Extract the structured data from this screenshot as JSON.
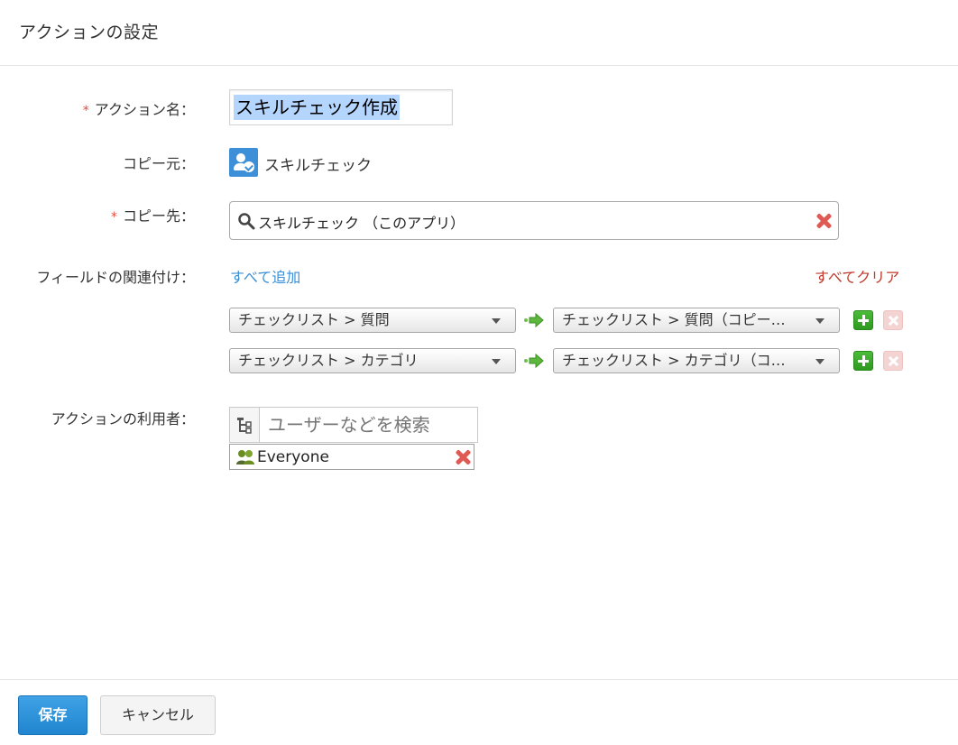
{
  "dialog": {
    "title": "アクションの設定"
  },
  "form": {
    "required_mark": "*",
    "action_name": {
      "label": "アクション名：",
      "value": "スキルチェック作成"
    },
    "copy_source": {
      "label": "コピー元：",
      "app_name": "スキルチェック",
      "icon": "app-person-check-icon"
    },
    "copy_dest": {
      "label": "コピー先：",
      "value": "スキルチェック （このアプリ）"
    },
    "field_mapping": {
      "label": "フィールドの関連付け：",
      "add_all": "すべて追加",
      "clear_all": "すべてクリア",
      "rows": [
        {
          "source": "チェックリスト > 質問",
          "dest": "チェックリスト > 質問（コピー…"
        },
        {
          "source": "チェックリスト > カテゴリ",
          "dest": "チェックリスト > カテゴリ（コ…"
        }
      ]
    },
    "action_users": {
      "label": "アクションの利用者：",
      "search_placeholder": "ユーザーなどを検索",
      "entities": [
        {
          "name": "Everyone",
          "icon": "group-icon"
        }
      ]
    }
  },
  "footer": {
    "save_label": "保存",
    "cancel_label": "キャンセル"
  },
  "colors": {
    "accent": "#2185cf",
    "link": "#3a8fd6",
    "danger": "#c0392b",
    "add": "#2e9a20"
  }
}
